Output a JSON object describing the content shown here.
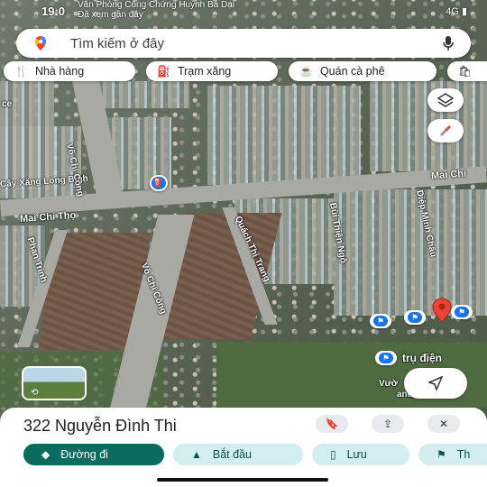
{
  "status_bar": {
    "time": "19:0",
    "notice_line1": "Văn Phòng Công Chứng Huỳnh Bá Dại",
    "notice_line2": "Đã xem gần đây",
    "network": "4G"
  },
  "search": {
    "placeholder": "Tìm kiếm ở đây"
  },
  "chips": [
    {
      "icon": "restaurant-icon",
      "label": "Nhà hàng"
    },
    {
      "icon": "gas-station-icon",
      "label": "Trạm xăng"
    },
    {
      "icon": "coffee-icon",
      "label": "Quán cà phê"
    }
  ],
  "map_labels": {
    "gas_station": "Cây Xăng Long Bình",
    "road_mai_chi_tho_left": "Mai Chí Thọ",
    "road_mai_chi_tho_right": "Mai Chí",
    "road_vo_chi_cong_top": "Võ Chí Công",
    "road_vo_chi_cong_mid": "Võ Chí Công",
    "road_phan_trinh": "Phan Trinh",
    "road_quach_thi_trang": "Quách Thị Trang",
    "road_bui_thien_ngo": "Bùi Thiện Ngộ",
    "road_diep_minh_chau": "Diệp Minh Châu",
    "poi_tru_dien": "trụ điện",
    "poi_vuon": "Vườ",
    "poi_chicken": "and CHICKE",
    "left_edge_ce": "ce"
  },
  "place": {
    "title": "322 Nguyễn Đình Thi",
    "actions": [
      {
        "icon": "directions-icon",
        "label": "Đường đi"
      },
      {
        "icon": "start-navigation-icon",
        "label": "Bắt đầu"
      },
      {
        "icon": "bookmark-icon",
        "label": "Lưu"
      },
      {
        "icon": "flag-icon",
        "label": "Th"
      }
    ]
  },
  "colors": {
    "pin": "#ea4335",
    "primary_action": "#0b6b5f",
    "secondary_action": "#d3eef0",
    "poi_blue": "#1a73e8"
  }
}
